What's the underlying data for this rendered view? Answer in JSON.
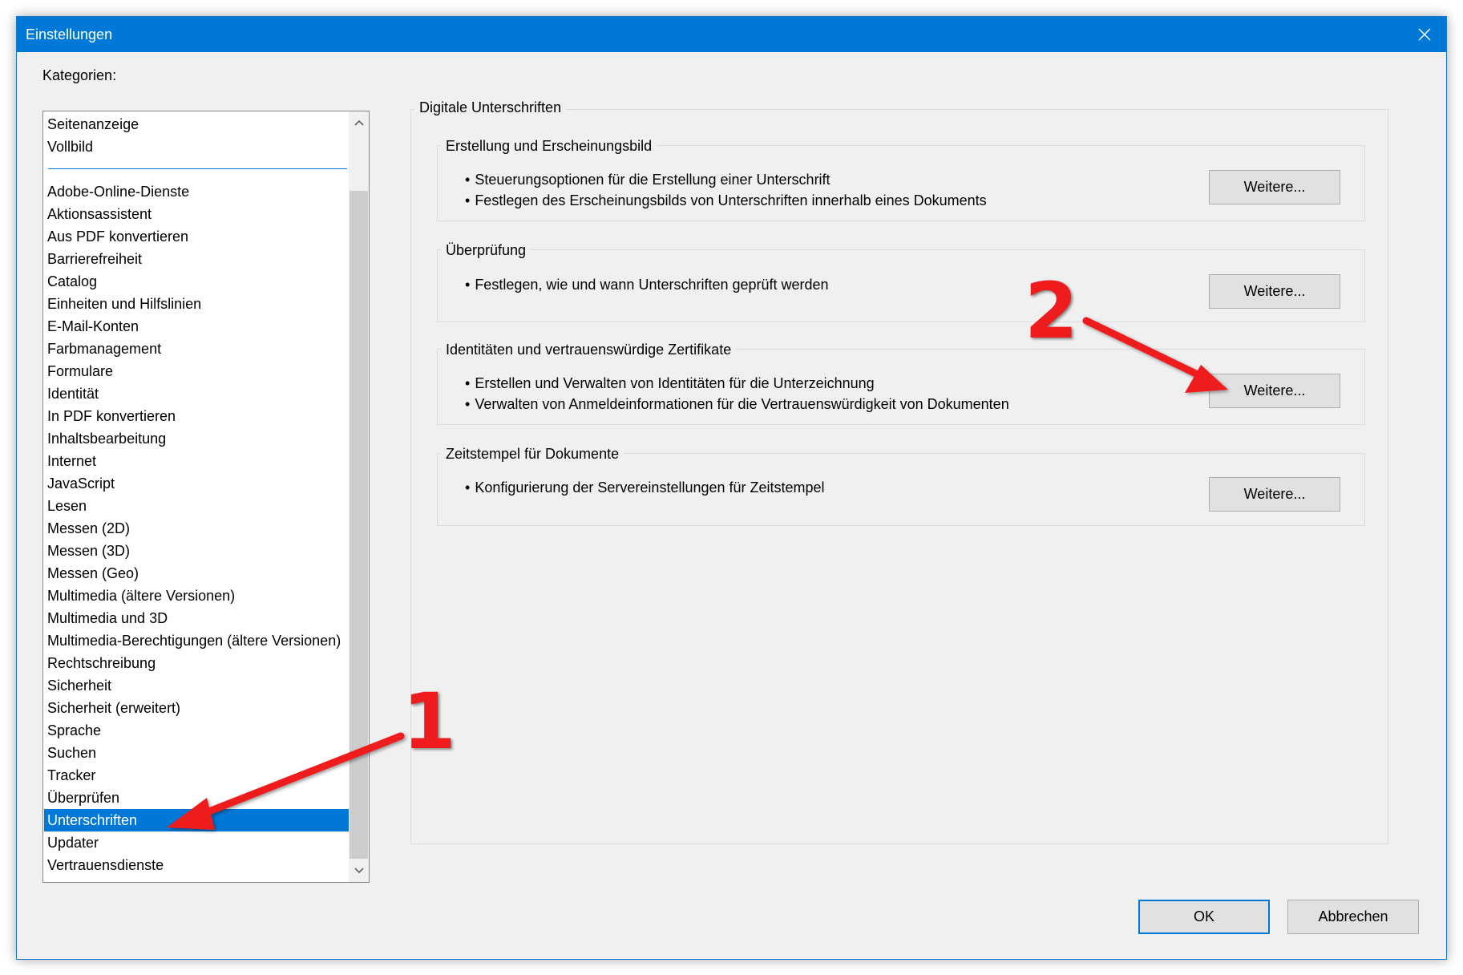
{
  "window": {
    "title": "Einstellungen",
    "close_icon": "close-icon",
    "accent_color": "#0078d7"
  },
  "categories": {
    "label": "Kategorien:",
    "pinned": [
      "Seitenanzeige",
      "Vollbild"
    ],
    "items": [
      "Adobe-Online-Dienste",
      "Aktionsassistent",
      "Aus PDF konvertieren",
      "Barrierefreiheit",
      "Catalog",
      "Einheiten und Hilfslinien",
      "E-Mail-Konten",
      "Farbmanagement",
      "Formulare",
      "Identität",
      "In PDF konvertieren",
      "Inhaltsbearbeitung",
      "Internet",
      "JavaScript",
      "Lesen",
      "Messen (2D)",
      "Messen (3D)",
      "Messen (Geo)",
      "Multimedia (ältere Versionen)",
      "Multimedia und 3D",
      "Multimedia-Berechtigungen (ältere Versionen)",
      "Rechtschreibung",
      "Sicherheit",
      "Sicherheit (erweitert)",
      "Sprache",
      "Suchen",
      "Tracker",
      "Überprüfen",
      "Unterschriften",
      "Updater",
      "Vertrauensdienste"
    ],
    "selected": "Unterschriften"
  },
  "main": {
    "group_title": "Digitale Unterschriften",
    "sections": [
      {
        "title": "Erstellung und Erscheinungsbild",
        "bullets": [
          "Steuerungsoptionen für die Erstellung einer Unterschrift",
          "Festlegen des Erscheinungsbilds von Unterschriften innerhalb eines Dokuments"
        ],
        "button": "Weitere..."
      },
      {
        "title": "Überprüfung",
        "bullets": [
          "Festlegen, wie und wann Unterschriften geprüft werden"
        ],
        "button": "Weitere..."
      },
      {
        "title": "Identitäten und vertrauenswürdige Zertifikate",
        "bullets": [
          "Erstellen und Verwalten von Identitäten für die Unterzeichnung",
          "Verwalten von Anmeldeinformationen für die Vertrauenswürdigkeit von Dokumenten"
        ],
        "button": "Weitere..."
      },
      {
        "title": "Zeitstempel für Dokumente",
        "bullets": [
          "Konfigurierung der Servereinstellungen für Zeitstempel"
        ],
        "button": "Weitere..."
      }
    ]
  },
  "footer": {
    "ok_label": "OK",
    "cancel_label": "Abbrechen"
  },
  "annotations": {
    "marker_1": "1",
    "marker_2": "2",
    "color": "#ee1c1c"
  }
}
